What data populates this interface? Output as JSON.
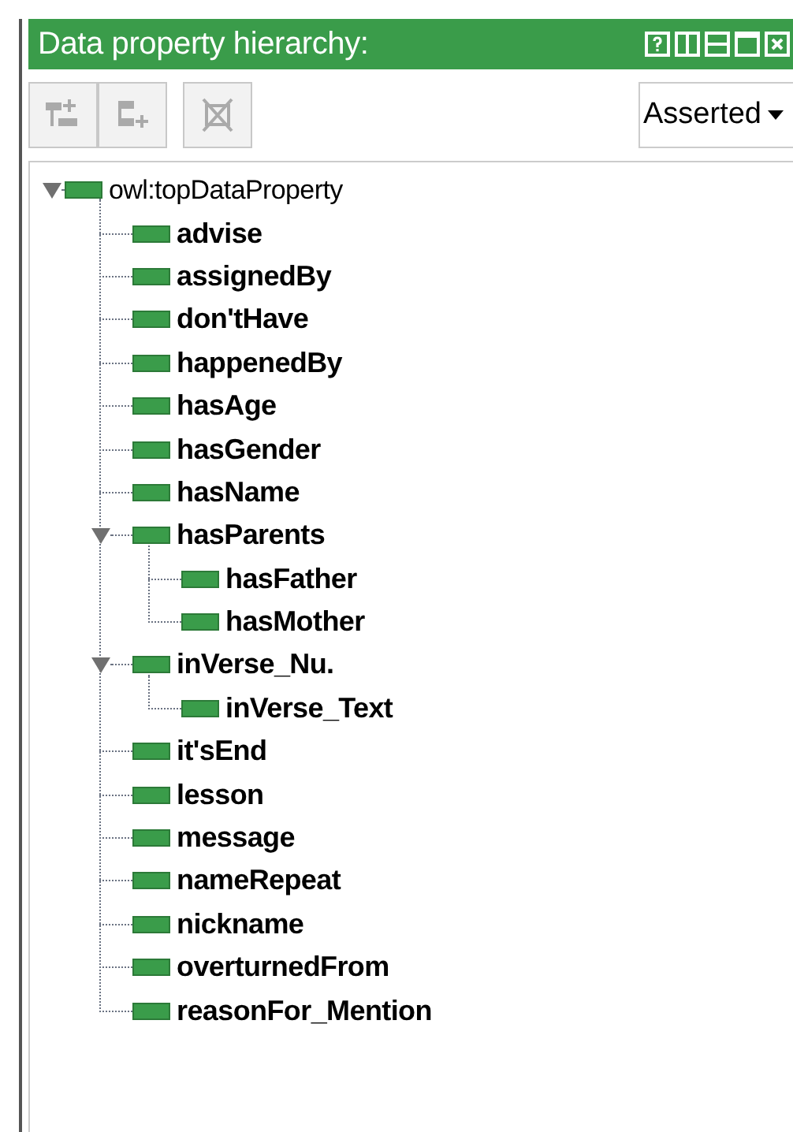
{
  "panel": {
    "title": "Data property hierarchy:"
  },
  "view_select": {
    "value": "Asserted"
  },
  "tree": [
    {
      "label": "owl:topDataProperty",
      "bold": false,
      "expanded": true,
      "children": [
        {
          "label": "advise",
          "bold": true
        },
        {
          "label": "assignedBy",
          "bold": true
        },
        {
          "label": "don'tHave",
          "bold": true
        },
        {
          "label": "happenedBy",
          "bold": true
        },
        {
          "label": "hasAge",
          "bold": true
        },
        {
          "label": "hasGender",
          "bold": true
        },
        {
          "label": "hasName",
          "bold": true
        },
        {
          "label": "hasParents",
          "bold": true,
          "expanded": true,
          "children": [
            {
              "label": "hasFather",
              "bold": true
            },
            {
              "label": "hasMother",
              "bold": true
            }
          ]
        },
        {
          "label": "inVerse_Nu.",
          "bold": true,
          "expanded": true,
          "children": [
            {
              "label": "inVerse_Text",
              "bold": true
            }
          ]
        },
        {
          "label": "it'sEnd",
          "bold": true
        },
        {
          "label": "lesson",
          "bold": true
        },
        {
          "label": "message",
          "bold": true
        },
        {
          "label": "nameRepeat",
          "bold": true
        },
        {
          "label": "nickname",
          "bold": true
        },
        {
          "label": "overturnedFrom",
          "bold": true
        },
        {
          "label": "reasonFor_Mention",
          "bold": true
        }
      ]
    }
  ]
}
